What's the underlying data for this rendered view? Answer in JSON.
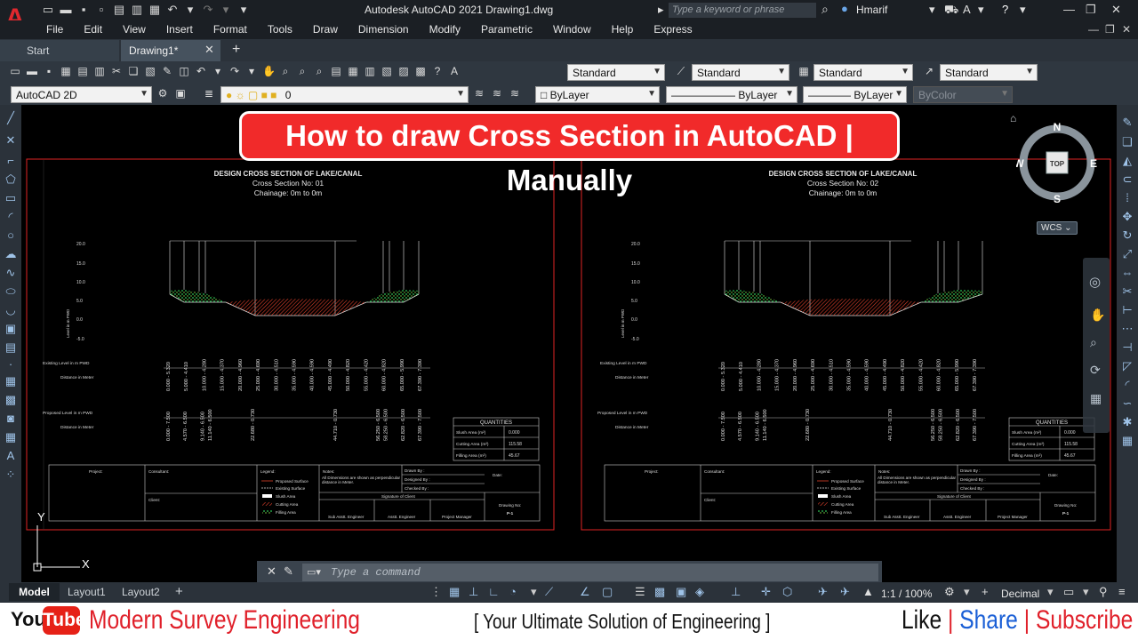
{
  "window": {
    "app_title": "Autodesk AutoCAD 2021    Drawing1.dwg",
    "search_placeholder": "Type a keyword or phrase",
    "user_name": "Hmarif"
  },
  "menu": [
    "File",
    "Edit",
    "View",
    "Insert",
    "Format",
    "Tools",
    "Draw",
    "Dimension",
    "Modify",
    "Parametric",
    "Window",
    "Help",
    "Express"
  ],
  "tabs": {
    "start": "Start",
    "drawing": "Drawing1*"
  },
  "toolbar": {
    "text_style": "Standard",
    "dim_style": "Standard",
    "table_style": "Standard",
    "mleader_style": "Standard",
    "workspace": "AutoCAD 2D",
    "layer": "0",
    "color": "ByLayer",
    "linetype": "ByLayer",
    "lineweight": "ByLayer",
    "plotstyle": "ByColor"
  },
  "banner": "How to draw Cross Section in AutoCAD | Manually",
  "viewcube": {
    "n": "N",
    "s": "S",
    "e": "E",
    "w": "W",
    "top": "TOP",
    "wcs": "WCS"
  },
  "sections": [
    {
      "title": "DESIGN CROSS SECTION OF LAKE/CANAL",
      "number": "Cross Section No: 01",
      "chainage": "Chainage: 0m to 0m",
      "sheet": "P-1"
    },
    {
      "title": "DESIGN CROSS SECTION OF LAKE/CANAL",
      "number": "Cross Section No: 02",
      "chainage": "Chainage: 0m to 0m",
      "sheet": "P-1"
    }
  ],
  "section_common": {
    "y_ticks": [
      "20.0",
      "15.0",
      "10.0",
      "5.0",
      "0.0",
      "-5.0"
    ],
    "y_label": "Level in m PWD",
    "row_existing_level": "Existing Level in m PWD",
    "row_distance": "Distance in Meter",
    "row_proposed_level": "Proposed Level in m PWD",
    "existing_values": [
      "0.000 - 5.320",
      "5.000 - 4.410",
      "10.000 - 4.280",
      "15.000 - 4.370",
      "20.000 - 4.960",
      "25.000 - 4.690",
      "30.000 - 4.510",
      "35.000 - 4.590",
      "40.000 - 4.590",
      "45.000 - 4.490",
      "50.000 - 4.820",
      "55.000 - 4.420",
      "60.000 - 4.820",
      "65.000 - 5.990",
      "67.390 - 7.390"
    ],
    "proposed_values": [
      "0.000 - 7.500",
      "4.570 - 6.500",
      "9.140 - 6.500",
      "11.140 - 6.500",
      "22.680 - 0.730",
      "44.710 - 0.730",
      "56.250 - 6.500",
      "58.250 - 6.500",
      "62.820 - 6.500",
      "67.390 - 7.500"
    ],
    "quantities": {
      "title": "QUANTITIES",
      "rows": [
        {
          "label": "Slush Area (m²)",
          "value": "0.000"
        },
        {
          "label": "Cutting Area (m²)",
          "value": "115.58"
        },
        {
          "label": "Filling Area (m²)",
          "value": "45.67"
        }
      ]
    },
    "titleblock": {
      "project": "Project:",
      "consultant": "Consultant:",
      "client": "Client:",
      "legend": "Legend:",
      "legend_items": [
        "Proposed Surface",
        "Existing Surface",
        "Slush Area",
        "Cutting Area",
        "Filling Area"
      ],
      "notes_label": "Notes:",
      "notes_text": "All Dimensions are shown as perpendicular distance in Meter.",
      "drawn_by": "Drawn By :",
      "designed_by": "Designed By :",
      "checked_by": "Checked By :",
      "date": "Date:",
      "signature": "Signature of Client",
      "sub_asst": "Sub Asstt. Engineer",
      "asst": "Asstt. Engineer",
      "pm": "Project Manager",
      "drawing_no": "Drawing No:"
    }
  },
  "command": {
    "placeholder": "Type a command"
  },
  "layout_tabs": [
    "Model",
    "Layout1",
    "Layout2"
  ],
  "status": {
    "scale": "1:1 / 100%",
    "units": "Decimal"
  },
  "footer": {
    "yt_you": "You",
    "yt_tube": "Tube",
    "channel": "Modern Survey Engineering",
    "tagline": "[ Your Ultimate Solution of Engineering ]",
    "like": "Like",
    "sep": "|",
    "share": "Share",
    "subscribe": "Subscribe"
  }
}
